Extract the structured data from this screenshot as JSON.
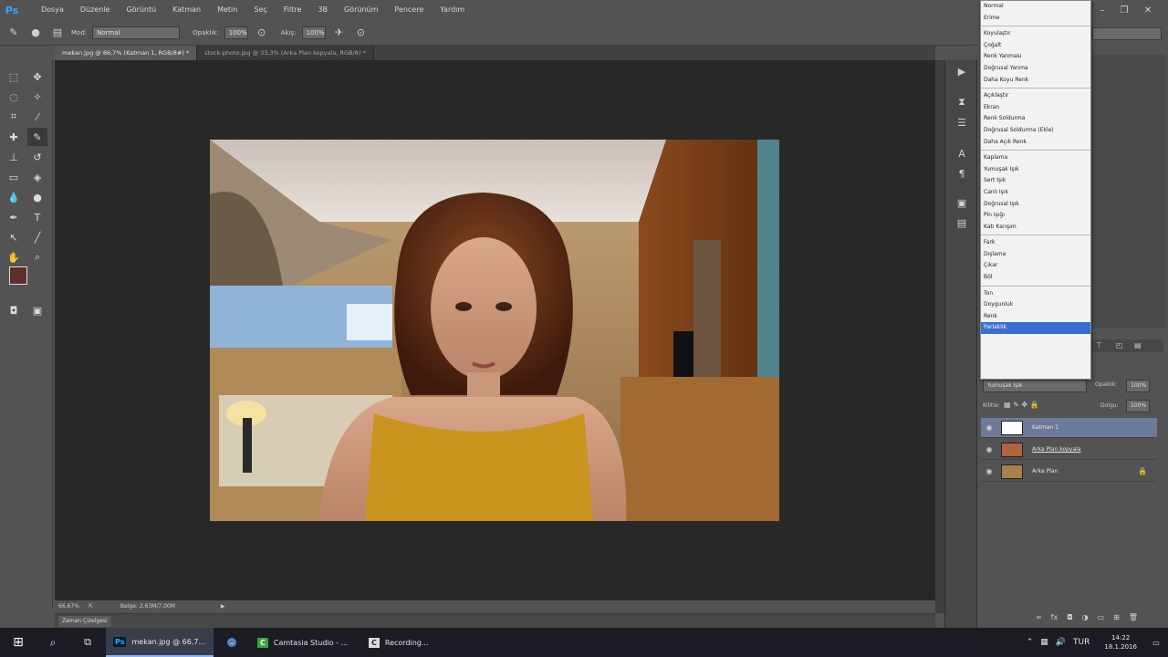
{
  "app": {
    "logo": "Ps"
  },
  "menu": [
    "Dosya",
    "Düzenle",
    "Görüntü",
    "Katman",
    "Metin",
    "Seç",
    "Filtre",
    "3B",
    "Görünüm",
    "Pencere",
    "Yardım"
  ],
  "options": {
    "mode_label": "Mod:",
    "mode_value": "Normal",
    "opacity_label": "Opaklık:",
    "opacity_value": "100%",
    "flow_label": "Akış:",
    "flow_value": "100%"
  },
  "doc_tabs": [
    {
      "label": "mekan.jpg @ 66,7% (Katman 1, RGB/8#) *"
    },
    {
      "label": "stock-photo.jpg @ 33,3% (Arka Plan kopyala, RGB/8) *"
    }
  ],
  "status": {
    "zoom": "66,67%",
    "doc_info": "Belge: 2,63M/7,00M"
  },
  "timeline_tab": "Zaman Çizelgesi",
  "blend_dropdown": {
    "groups": [
      [
        "Normal",
        "Erime"
      ],
      [
        "Koyulaştır",
        "Çoğalt",
        "Renk Yanması",
        "Doğrusal Yanma",
        "Daha Koyu Renk"
      ],
      [
        "Açıklaştır",
        "Ekran",
        "Renk Soldurma",
        "Doğrusal Soldurma (Ekle)",
        "Daha Açık Renk"
      ],
      [
        "Kaplama",
        "Yumuşak Işık",
        "Sert Işık",
        "Canlı Işık",
        "Doğrusal Işık",
        "Pin Işığı",
        "Katı Karışım"
      ],
      [
        "Fark",
        "Dışlama",
        "Çıkar",
        "Böl"
      ],
      [
        "Ton",
        "Doygunluk",
        "Renk",
        "Parlaklık"
      ]
    ],
    "selected": "Parlaklık"
  },
  "layers_panel": {
    "blend_value": "Yumuşak Işık",
    "opacity_label": "Opaklık:",
    "opacity_value": "100%",
    "lock_label": "Kilitle:",
    "fill_label": "Dolgu:",
    "fill_value": "100%",
    "layers": [
      {
        "name": "Katman 1",
        "selected": true
      },
      {
        "name": "Arka Plan kopyala",
        "selected": false
      },
      {
        "name": "Arka Plan",
        "selected": false
      }
    ]
  },
  "taskbar": {
    "apps": [
      {
        "label": "mekan.jpg @ 66,7..."
      },
      {
        "label": "Camtasia Studio - ..."
      },
      {
        "label": "Recording..."
      }
    ],
    "time": "14:22",
    "date": "18.1.2016"
  },
  "colors": {
    "accent": "#31a8ff",
    "selection": "#3a6fd0",
    "foreground_swatch": "#5a3028",
    "background_swatch": "#000000"
  }
}
